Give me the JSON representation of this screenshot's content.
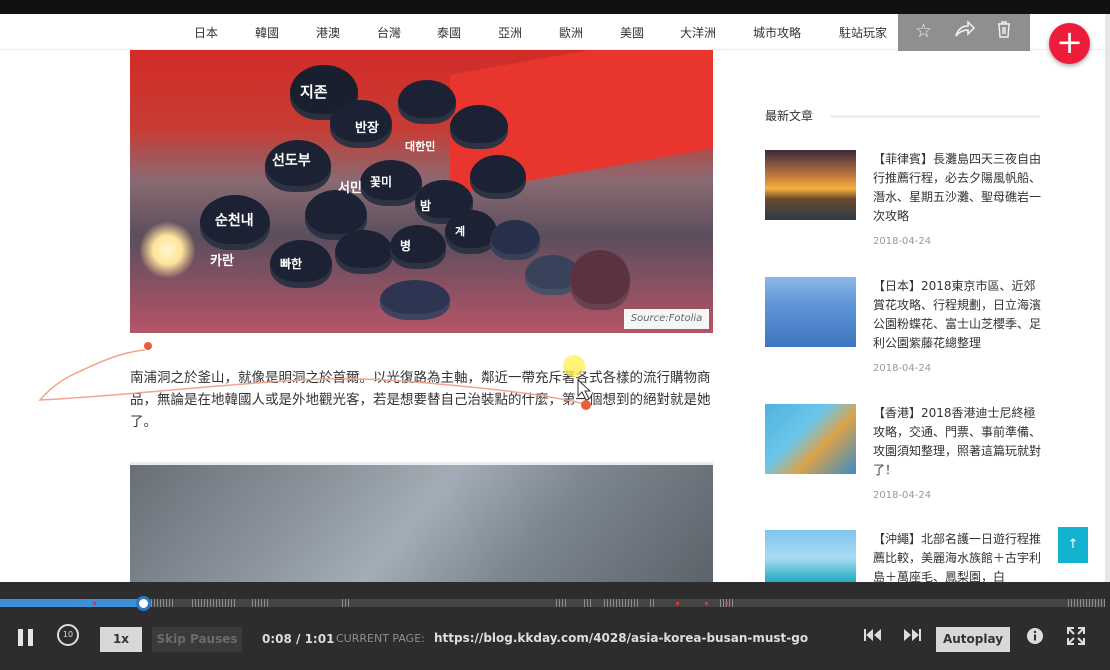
{
  "nav": {
    "items": [
      "日本",
      "韓國",
      "港澳",
      "台灣",
      "泰國",
      "亞洲",
      "歐洲",
      "美國",
      "大洋洲",
      "城市攻略",
      "駐站玩家"
    ],
    "actions": {
      "star": "star-icon",
      "share": "share-icon",
      "delete": "trash-icon",
      "add": "+"
    }
  },
  "article": {
    "image_source": "Source:Fotolia",
    "cap_text": [
      "지존",
      "반장",
      "선도부",
      "서민",
      "대한민",
      "순천내",
      "꽃미",
      "밤",
      "카란",
      "빠한",
      "병",
      "계"
    ],
    "paragraph": "南浦洞之於釜山，就像是明洞之於首爾。以光復路為主軸，鄰近一帶充斥著各式各樣的流行購物商品，無論是在地韓國人或是外地觀光客，若是想要替自己治裝點的什麼，第一個想到的絕對就是她了。"
  },
  "sidebar": {
    "title": "最新文章",
    "items": [
      {
        "title": "【菲律賓】長灘島四天三夜自由行推薦行程，必去夕陽風帆船、潛水、星期五沙灘、聖母礁岩一次攻略",
        "date": "2018-04-24"
      },
      {
        "title": "【日本】2018東京市區、近郊賞花攻略、行程規劃，日立海濱公園粉蝶花、富士山芝櫻季、足利公園紫藤花總整理",
        "date": "2018-04-24"
      },
      {
        "title": "【香港】2018香港迪士尼終極攻略，交通、門票、事前準備、攻園須知整理，照著這篇玩就對了！",
        "date": "2018-04-24"
      },
      {
        "title": "【沖繩】北部名護一日遊行程推薦比較，美麗海水族館＋古宇利島＋萬座毛、鳳梨園，白",
        "date": ""
      }
    ],
    "back_to_top": "↑"
  },
  "player": {
    "speed": "1x",
    "skip_pauses": "Skip Pauses",
    "time": "0:08 / 1:01",
    "current_page_label": "CURRENT PAGE:",
    "current_page_url": "https://blog.kkday.com/4028/asia-korea-busan-must-go",
    "autoplay": "Autoplay",
    "progress_fraction": 0.131,
    "icons": [
      "pause-icon",
      "rewind-10-icon",
      "skip-previous-icon",
      "skip-next-icon",
      "info-icon",
      "fullscreen-icon"
    ]
  },
  "colors": {
    "fab": "#ed1c3b",
    "back_to_top": "#11b3d0",
    "progress": "#3d8fd8",
    "annotation": "#f2a58e"
  }
}
